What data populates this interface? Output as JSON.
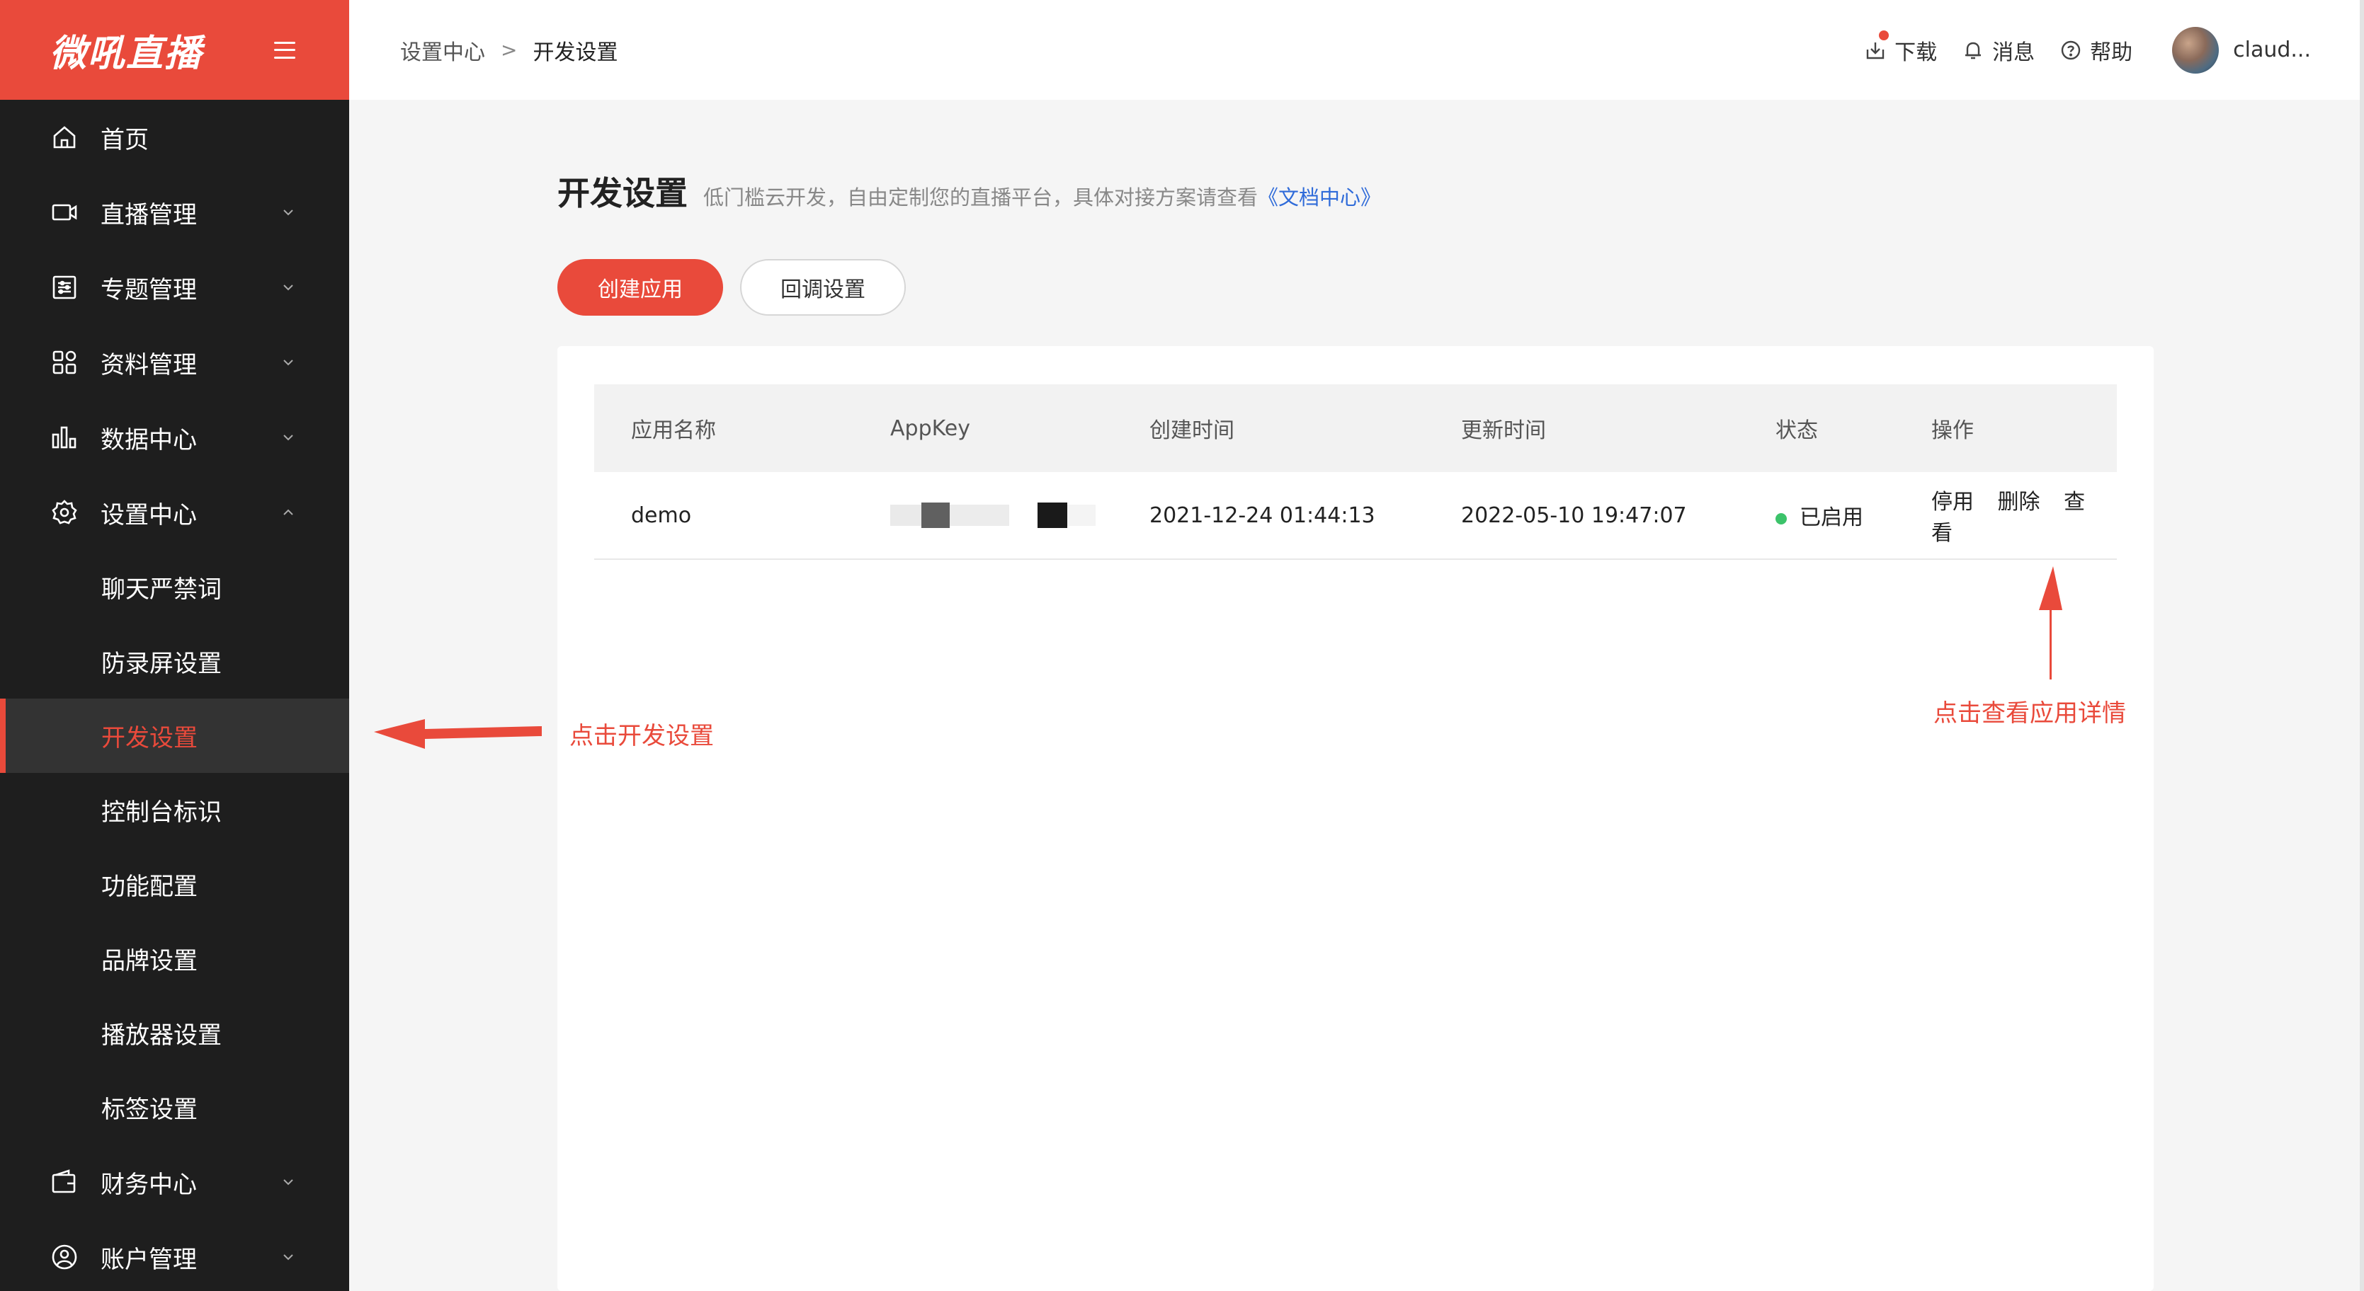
{
  "sidebar": {
    "logo": "微吼直播",
    "items": [
      {
        "label": "首页",
        "icon": "home-icon"
      },
      {
        "label": "直播管理",
        "icon": "video-camera-icon"
      },
      {
        "label": "专题管理",
        "icon": "topic-icon"
      },
      {
        "label": "资料管理",
        "icon": "grid-icon"
      },
      {
        "label": "数据中心",
        "icon": "bar-chart-icon"
      },
      {
        "label": "设置中心",
        "icon": "gear-icon"
      }
    ],
    "settings_sub": [
      {
        "label": "聊天严禁词"
      },
      {
        "label": "防录屏设置"
      },
      {
        "label": "开发设置"
      },
      {
        "label": "控制台标识"
      },
      {
        "label": "功能配置"
      },
      {
        "label": "品牌设置"
      },
      {
        "label": "播放器设置"
      },
      {
        "label": "标签设置"
      }
    ],
    "bottom_items": [
      {
        "label": "财务中心",
        "icon": "wallet-icon"
      },
      {
        "label": "账户管理",
        "icon": "user-icon"
      }
    ]
  },
  "header": {
    "breadcrumb_parent": "设置中心",
    "breadcrumb_sep": ">",
    "breadcrumb_current": "开发设置",
    "download": "下载",
    "messages": "消息",
    "help": "帮助",
    "username": "claud..."
  },
  "main": {
    "title": "开发设置",
    "description": "低门槛云开发，自由定制您的直播平台，具体对接方案请查看",
    "doc_link": "《文档中心》",
    "create_app": "创建应用",
    "callback_settings": "回调设置",
    "table": {
      "headers": [
        "应用名称",
        "AppKey",
        "创建时间",
        "更新时间",
        "状态",
        "操作"
      ],
      "rows": [
        {
          "name": "demo",
          "created": "2021-12-24 01:44:13",
          "updated": "2022-05-10 19:47:07",
          "status": "已启用",
          "ops": [
            "停用",
            "删除",
            "查看"
          ]
        }
      ]
    }
  },
  "annotations": {
    "left": "点击开发设置",
    "right": "点击查看应用详情"
  },
  "colors": {
    "accent": "#e94a3b",
    "sidebar_bg": "#1e1e1e",
    "status_green": "#3cc36a",
    "link_blue": "#2f6bd9"
  }
}
